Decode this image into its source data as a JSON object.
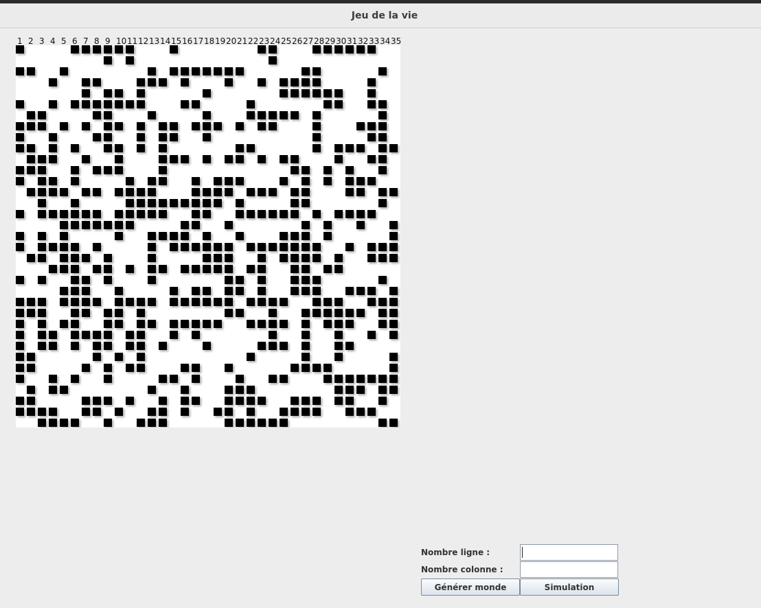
{
  "window": {
    "title": "Jeu de la vie"
  },
  "grid": {
    "columns": [
      "1",
      "2",
      "3",
      "4",
      "5",
      "6",
      "7",
      "8",
      "9",
      "10",
      "11",
      "12",
      "13",
      "14",
      "15",
      "16",
      "17",
      "18",
      "19",
      "20",
      "21",
      "22",
      "23",
      "24",
      "25",
      "26",
      "27",
      "28",
      "29",
      "30",
      "31",
      "32",
      "33",
      "34",
      "35"
    ],
    "rows": [
      "#....######...#.......##...######.",
      "........#.#............#..........",
      "##..#.......#.#######.....##.....#",
      "...#..##...###.#...#..#.####....#.",
      "......#.##.#.....#......######..#.",
      "#..#.#######...##....#......##..##",
      ".##....##...#....#...#####.#.....#",
      "###.#.#.##.#.##.###.#.##...#...###",
      "#..#...##..#.##..#.........#....##",
      "##.#.#..##.#.#......##.....#.###.##",
      ".###..#..#...###.#.##.#.##...#..##",
      "###..#.###...#...........##.#.#..#",
      "#.##.#....#.##..#.###...#.#.#.###.",
      ".####.##.####...####.###.##...##.##",
      "..#..#....#########.#....##......#.",
      "#.######.#####..##..######.#.####..",
      "....#######....##..#......#.#..#..#",
      "#.#.#....#..####.#..#...###.#.....#",
      "#.####.#....#.######.#######..#.###",
      ".##.###.#...#....###..#.####.#..###",
      "...###.##.#.##.#####.##..##.##.....",
      "#.#..##.#...#......##.#..###.....#.",
      "....###..#....#.##.##.#..###..###.#",
      "###.####.####.######.####..###..###",
      "###..##.##.#.......##..#..######.##",
      "#.#.##..##.##.#####..####.#.###..##",
      "#.##.####.##..#.#......#..#..#..#.#",
      "#.##.#.##.##.#...#....###.#..##....",
      "##.....#.#.#.........#....#..#....#",
      "##....#.#.##...##..#.....####.....#",
      "#..#.#..#....##.#...#..##...#######",
      ".#.##.......#..#...###.......###.##",
      "##....###.#..#.##..####..###.##..#.",
      "####..##.#..##.#..##.#..####..###..",
      "..####..#..###.....######........##",
      "##...#.#..##....####.....##..#.#...#"
    ]
  },
  "form": {
    "rows_label": "Nombre ligne :",
    "cols_label": "Nombre colonne :",
    "rows_value": "",
    "cols_value": "",
    "generate_label": "Générer monde",
    "simulate_label": "Simulation"
  }
}
